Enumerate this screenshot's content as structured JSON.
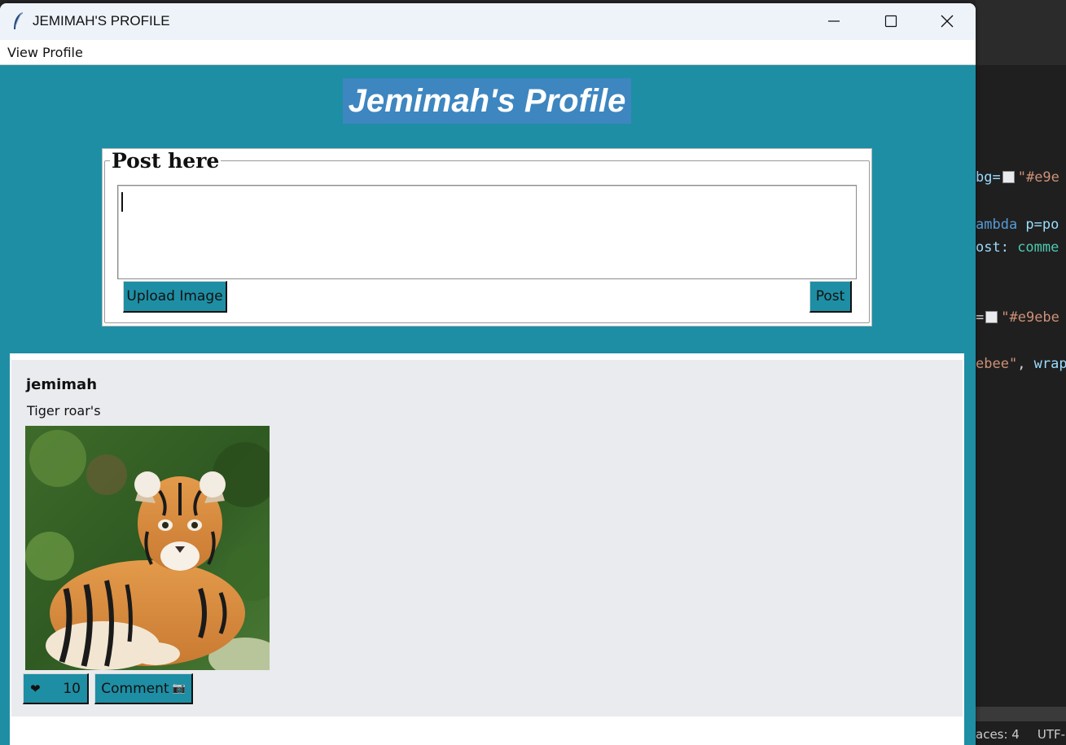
{
  "window": {
    "title": "JEMIMAH'S PROFILE",
    "controls": {
      "minimize": "minimize-icon",
      "maximize": "maximize-icon",
      "close": "close-icon"
    }
  },
  "menubar": {
    "items": [
      "View Profile"
    ]
  },
  "profile": {
    "heading": "Jemimah's Profile",
    "heading_bg": "#3d86c0",
    "background": "#1e8ea4"
  },
  "composer": {
    "legend": "Post here",
    "text_value": "",
    "upload_label": "Upload Image",
    "post_label": "Post"
  },
  "feed": {
    "posts": [
      {
        "author": "jemimah",
        "text": "Tiger roar's",
        "image": "tiger-cub-photo",
        "like_icon": "❤",
        "likes": "10",
        "comment_label": "Comment",
        "comment_icon": "📷"
      }
    ],
    "card_bg": "#e9ebee"
  },
  "background_editor": {
    "lines": [
      [
        "bg=",
        "swatch",
        "\"#e9e"
      ],
      [
        "ambda p=po"
      ],
      [
        "ost: comme"
      ],
      [
        "=",
        "swatch",
        "\"#e9ebe"
      ],
      [
        "ebee\", wrap"
      ]
    ],
    "status": [
      "aces: 4",
      "UTF-"
    ]
  }
}
